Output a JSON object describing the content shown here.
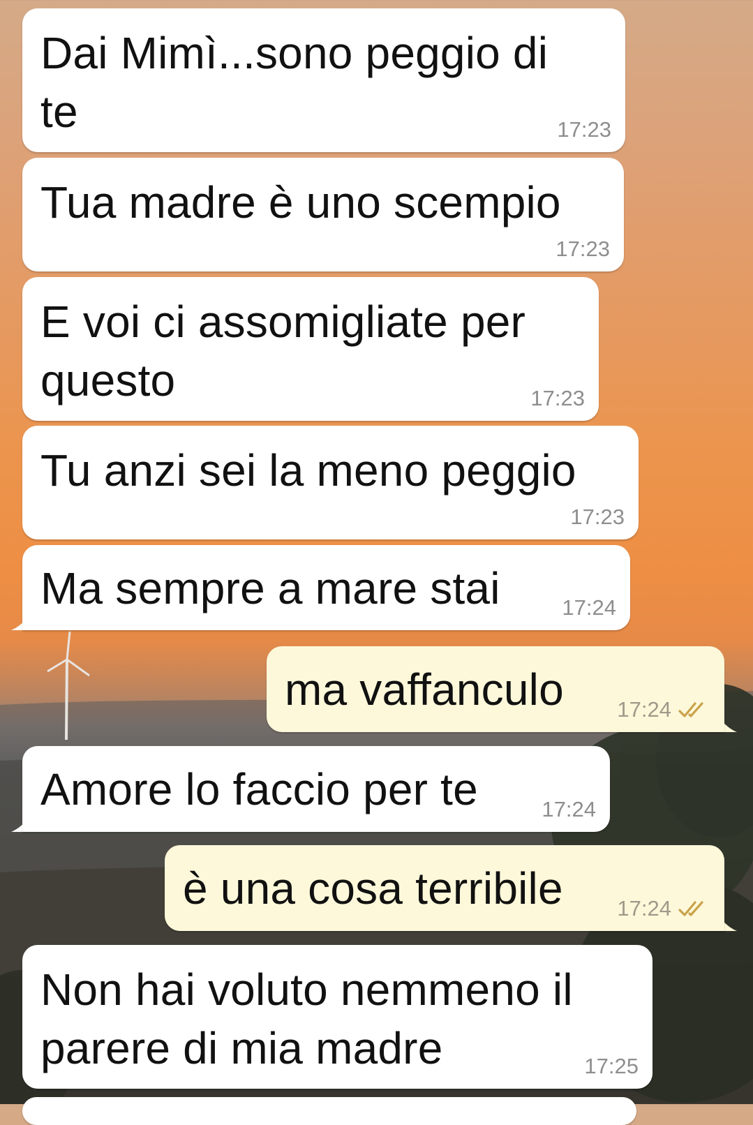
{
  "messages": [
    {
      "direction": "in",
      "text": "Dai Mimì...sono peggio di\nte",
      "time": "17:23"
    },
    {
      "direction": "in",
      "text": "Tua madre è uno scempio",
      "time": "17:23"
    },
    {
      "direction": "in",
      "text": "E voi ci assomigliate per\nquesto",
      "time": "17:23"
    },
    {
      "direction": "in",
      "text": "Tu anzi sei la meno peggio",
      "time": "17:23"
    },
    {
      "direction": "in",
      "text": "Ma sempre a mare stai",
      "time": "17:24"
    },
    {
      "direction": "out",
      "text": "ma vaffanculo",
      "time": "17:24",
      "status_icon": "double-check-icon"
    },
    {
      "direction": "in",
      "text": "Amore lo faccio per te",
      "time": "17:24"
    },
    {
      "direction": "out",
      "text": "è una cosa terribile",
      "time": "17:24",
      "status_icon": "double-check-icon"
    },
    {
      "direction": "in",
      "text": "Non hai voluto nemmeno il\nparere di mia madre",
      "time": "17:25"
    }
  ],
  "colors": {
    "incoming_bubble": "#ffffff",
    "outgoing_bubble": "#fdf8da",
    "timestamp": "#8e8e8e",
    "tick": "#c9a24a"
  }
}
